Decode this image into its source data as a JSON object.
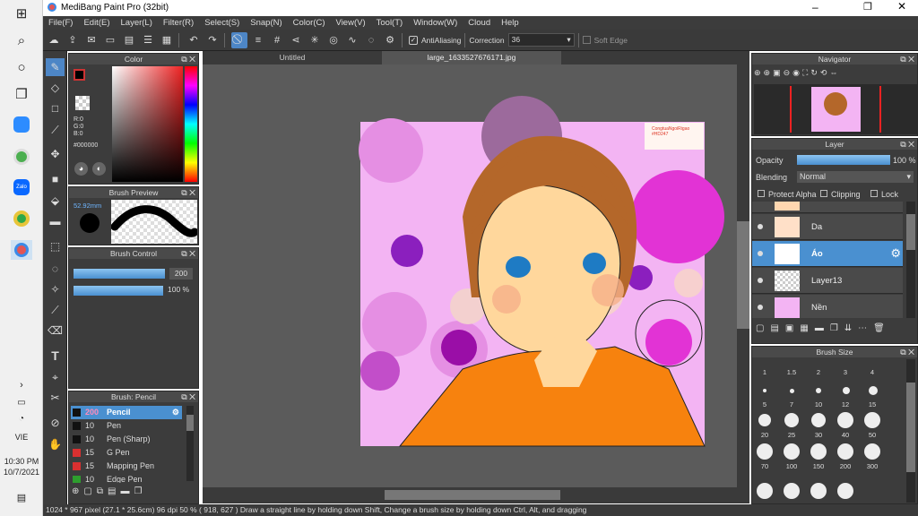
{
  "window": {
    "title": "MediBang Paint Pro (32bit)"
  },
  "menu": [
    "File(F)",
    "Edit(E)",
    "Layer(L)",
    "Filter(R)",
    "Select(S)",
    "Snap(N)",
    "Color(C)",
    "View(V)",
    "Tool(T)",
    "Window(W)",
    "Cloud",
    "Help"
  ],
  "toolbar": {
    "antialiasing": "AntiAliasing",
    "correction_label": "Correction",
    "correction_value": "36",
    "soft_edge": "Soft Edge"
  },
  "taskbar": {
    "lang": "VIE",
    "time": "10:30 PM",
    "date": "10/7/2021"
  },
  "tabs": [
    "Untitled",
    "large_1633527676171.jpg"
  ],
  "color_panel": {
    "title": "Color",
    "r": "R:0",
    "g": "G:0",
    "b": "B:0",
    "hex": "#000000"
  },
  "brush_preview": {
    "title": "Brush Preview",
    "size": "52.92mm"
  },
  "brush_control": {
    "title": "Brush Control",
    "size_value": "200",
    "opacity_value": "100 %"
  },
  "brush_list": {
    "title": "Brush: Pencil",
    "items": [
      {
        "num": "200",
        "name": "Pencil",
        "color": "#111111"
      },
      {
        "num": "10",
        "name": "Pen",
        "color": "#111111"
      },
      {
        "num": "10",
        "name": "Pen (Sharp)",
        "color": "#111111"
      },
      {
        "num": "15",
        "name": "G Pen",
        "color": "#d93030"
      },
      {
        "num": "15",
        "name": "Mapping Pen",
        "color": "#d93030"
      },
      {
        "num": "10",
        "name": "Edge Pen",
        "color": "#2e9e2e"
      }
    ]
  },
  "navigator": {
    "title": "Navigator"
  },
  "layer_panel": {
    "title": "Layer",
    "opacity_label": "Opacity",
    "opacity_value": "100 %",
    "blending_label": "Blending",
    "blending_value": "Normal",
    "protect_alpha": "Protect Alpha",
    "clipping": "Clipping",
    "lock": "Lock",
    "layers": [
      {
        "name": "Da"
      },
      {
        "name": "Áo"
      },
      {
        "name": "Layer13"
      },
      {
        "name": "Nền"
      }
    ]
  },
  "brush_size": {
    "title": "Brush Size",
    "labels": [
      "1",
      "1.5",
      "2",
      "3",
      "4",
      "5",
      "7",
      "10",
      "12",
      "15",
      "20",
      "25",
      "30",
      "40",
      "50",
      "70",
      "100",
      "150",
      "200",
      "300"
    ]
  },
  "canvas": {
    "watermark": "CongtuaNgoiRigao #HD247"
  },
  "status": "1024 * 967 pixel   (27.1 * 25.6cm)   96 dpi   50 %   ( 918, 627 )   Draw a straight line by holding down Shift, Change a brush size by holding down Ctrl, Alt, and dragging"
}
